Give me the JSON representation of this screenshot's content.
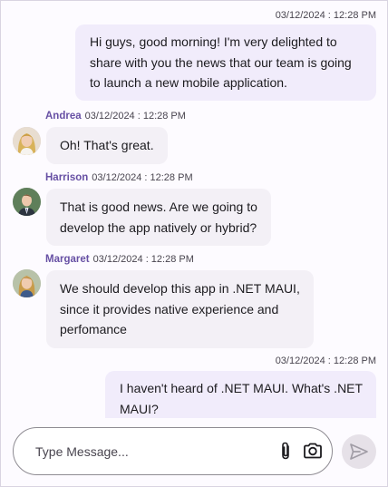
{
  "messages": [
    {
      "direction": "outgoing",
      "timestamp": "03/12/2024 : 12:28 PM",
      "lines": [
        "Hi guys, good morning! I'm very delighted to",
        "share with you the news that our team is going",
        "to launch a new mobile application."
      ]
    },
    {
      "direction": "incoming",
      "author": "Andrea",
      "timestamp": "03/12/2024 : 12:28 PM",
      "lines": [
        "Oh! That's great."
      ],
      "avatar_icon": "avatar-andrea"
    },
    {
      "direction": "incoming",
      "author": "Harrison",
      "timestamp": "03/12/2024 : 12:28 PM",
      "lines": [
        "That is good news. Are we going to",
        "develop the app natively or hybrid?"
      ],
      "avatar_icon": "avatar-harrison"
    },
    {
      "direction": "incoming",
      "author": "Margaret",
      "timestamp": "03/12/2024 : 12:28 PM",
      "lines": [
        "We should develop this app in .NET MAUI,",
        "since it provides native experience and",
        "perfomance"
      ],
      "avatar_icon": "avatar-margaret"
    },
    {
      "direction": "outgoing",
      "timestamp": "03/12/2024 : 12:28 PM",
      "lines": [
        "I haven't heard of .NET MAUI. What's .NET",
        "MAUI?"
      ]
    }
  ],
  "composer": {
    "placeholder": "Type Message...",
    "value": "",
    "attach_icon": "paperclip-icon",
    "camera_icon": "camera-icon",
    "send_icon": "send-icon"
  },
  "colors": {
    "author_name": "#6750a4",
    "outgoing_bubble": "#f1ecfb",
    "incoming_bubble": "#f3f0f6",
    "send_button": "#e6e1e8"
  }
}
